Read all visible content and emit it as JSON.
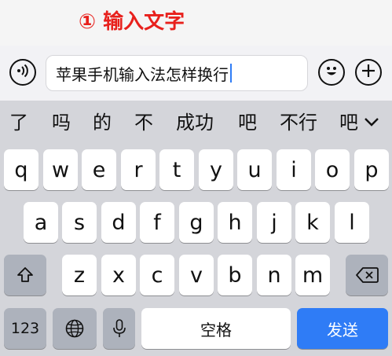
{
  "banner": {
    "step_title": "① 输入文字"
  },
  "input_bar": {
    "voice_icon": "voice-icon",
    "text": "苹果手机输入法怎样换行",
    "emoji_icon": "emoji-icon",
    "add_icon": "plus-icon"
  },
  "candidates": [
    "了",
    "吗",
    "的",
    "不",
    "成功",
    "吧",
    "不行",
    "吧"
  ],
  "keyboard": {
    "row1": [
      "q",
      "w",
      "e",
      "r",
      "t",
      "y",
      "u",
      "i",
      "o",
      "p"
    ],
    "row2": [
      "a",
      "s",
      "d",
      "f",
      "g",
      "h",
      "j",
      "k",
      "l"
    ],
    "row3": [
      "z",
      "x",
      "c",
      "v",
      "b",
      "n",
      "m"
    ],
    "num_label": "123",
    "space_label": "空格",
    "send_label": "发送",
    "icons": {
      "shift": "shift-icon",
      "globe": "globe-icon",
      "mic": "microphone-icon",
      "delete": "backspace-icon",
      "expand": "chevron-down-icon"
    },
    "colors": {
      "send": "#2f7cf6",
      "func_keys": "#adb2bc",
      "keyboard_bg": "#d4d5da",
      "title": "#e8201c"
    }
  }
}
